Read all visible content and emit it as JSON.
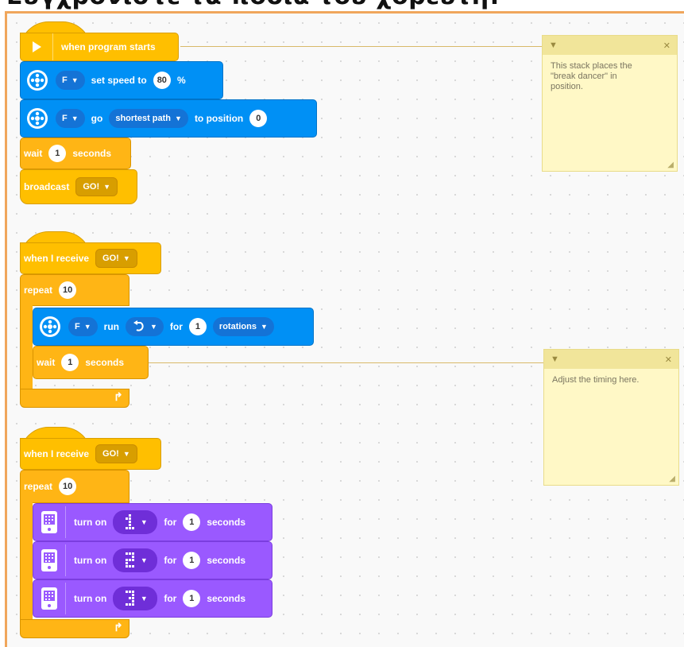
{
  "page_title": "Συγχρονίστε τα πόδια του χορευτή!",
  "colors": {
    "events": "#ffbf00",
    "control": "#ffb515",
    "motors": "#0090f5",
    "light": "#9a59ff",
    "comment": "#fff8c6",
    "canvas_border": "#f0a65c"
  },
  "stack1": {
    "hat": {
      "icon": "play-icon",
      "label": "when program starts"
    },
    "set_speed": {
      "port": "F",
      "label": "set speed to",
      "value": "80",
      "unit": "%"
    },
    "go_position": {
      "port": "F",
      "go_label": "go",
      "direction": "shortest path",
      "to_label": "to position",
      "position": "0"
    },
    "wait": {
      "label": "wait",
      "value": "1",
      "unit": "seconds"
    },
    "broadcast": {
      "label": "broadcast",
      "message": "GO!"
    }
  },
  "stack2": {
    "hat": {
      "label": "when I receive",
      "message": "GO!"
    },
    "repeat": {
      "label": "repeat",
      "value": "10"
    },
    "run": {
      "port": "F",
      "label": "run",
      "direction_icon": "counterclockwise-arrow-icon",
      "for_label": "for",
      "value": "1",
      "unit": "rotations"
    },
    "wait": {
      "label": "wait",
      "value": "1",
      "unit": "seconds"
    }
  },
  "stack3": {
    "hat": {
      "label": "when I receive",
      "message": "GO!"
    },
    "repeat": {
      "label": "repeat",
      "value": "10"
    },
    "light_blocks": [
      {
        "label": "turn on",
        "pattern_icon": "digit-1-matrix-icon",
        "for_label": "for",
        "value": "1",
        "unit": "seconds"
      },
      {
        "label": "turn on",
        "pattern_icon": "digit-2-matrix-icon",
        "for_label": "for",
        "value": "1",
        "unit": "seconds"
      },
      {
        "label": "turn on",
        "pattern_icon": "digit-3-matrix-icon",
        "for_label": "for",
        "value": "1",
        "unit": "seconds"
      }
    ]
  },
  "comments": [
    {
      "text": "This stack places the\n\"break dancer\" in\nposition."
    },
    {
      "text": "Adjust the timing here."
    }
  ]
}
